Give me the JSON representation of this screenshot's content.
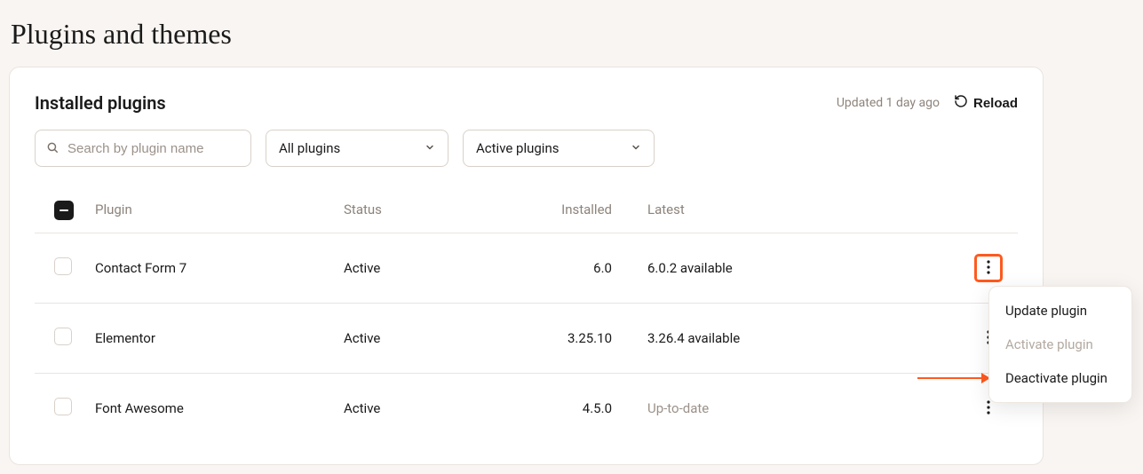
{
  "page": {
    "title": "Plugins and themes"
  },
  "card": {
    "title": "Installed plugins",
    "updated_text": "Updated 1 day ago",
    "reload_label": "Reload"
  },
  "filters": {
    "search_placeholder": "Search by plugin name",
    "scope": {
      "selected": "All plugins"
    },
    "state": {
      "selected": "Active plugins"
    }
  },
  "table": {
    "columns": {
      "plugin": "Plugin",
      "status": "Status",
      "installed": "Installed",
      "latest": "Latest"
    },
    "rows": [
      {
        "name": "Contact Form 7",
        "status": "Active",
        "installed": "6.0",
        "latest": "6.0.2 available",
        "latest_muted": false,
        "menu_highlighted": true
      },
      {
        "name": "Elementor",
        "status": "Active",
        "installed": "3.25.10",
        "latest": "3.26.4 available",
        "latest_muted": false,
        "menu_highlighted": false
      },
      {
        "name": "Font Awesome",
        "status": "Active",
        "installed": "4.5.0",
        "latest": "Up-to-date",
        "latest_muted": true,
        "menu_highlighted": false
      }
    ]
  },
  "dropdown": {
    "items": [
      {
        "label": "Update plugin",
        "disabled": false
      },
      {
        "label": "Activate plugin",
        "disabled": true
      },
      {
        "label": "Deactivate plugin",
        "disabled": false
      }
    ]
  },
  "icons": {
    "search": "search-icon",
    "chevron_down": "chevron-down-icon",
    "reload": "reload-icon",
    "kebab": "more-vertical-icon"
  },
  "annotation": {
    "highlight_color": "#ff5a1f"
  }
}
